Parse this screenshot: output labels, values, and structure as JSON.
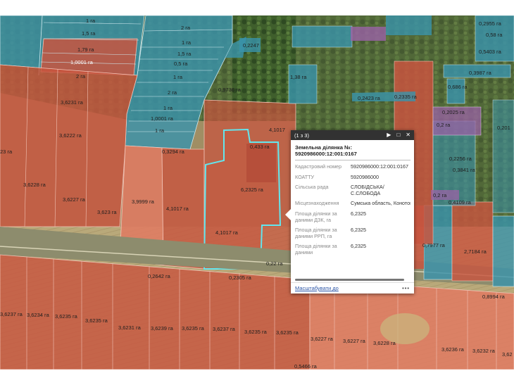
{
  "parcels": {
    "top_blue_left": [
      "1 га",
      "1,5 га",
      "1,79 га",
      "1,0001 га",
      "2 га"
    ],
    "top_blue_mid": [
      "2 га",
      "1 га",
      "1,5 га",
      "0,5 га",
      "1 га",
      "2 га",
      "1 га",
      "1,0001 га",
      "1 га"
    ],
    "top_misc": [
      "0,2247",
      "1,38 га",
      "0,9736 га",
      "0,2335 га",
      "0,2423 га",
      "0,2955 га",
      "0,58 га",
      "0,5403 га",
      "0,3987 га",
      "0,686 га",
      "0,2025 га",
      "0,2256 га",
      "0,3841 га",
      "0,4109 га",
      "0,201",
      "0,2 га",
      "0,2 га"
    ],
    "left_red": [
      "3,6231 га",
      "3,6222 га",
      "3,6228 га",
      "3,6227 га",
      "3,623 га",
      "3,9999 га",
      "4,1017 га",
      "0,3294 га",
      "23 га"
    ],
    "center": [
      "4,1017 га",
      "4,1017",
      "0,433 га",
      "6,2325 га",
      "0,22 га"
    ],
    "right": [
      "0,7977 га",
      "2,7184 га",
      "0,8994 га"
    ],
    "road": [
      "0,2642 га",
      "0,2305 га"
    ],
    "bottom_left": [
      "3,6237 га",
      "3,6234 га",
      "3,6235 га",
      "3,6235 га",
      "3,6231 га",
      "3,6239 га",
      "3,6235 га",
      "3,6237 га",
      "3,6235 га",
      "3,6235 га"
    ],
    "bottom_right": [
      "3,6227 га",
      "3,6227 га",
      "3,6228 га",
      "3,6236 га",
      "3,6232 га",
      "3,62"
    ],
    "bottom_misc": [
      "0,5466 га"
    ]
  },
  "popup": {
    "counter": "(1 з 3)",
    "title_line1": "Земельна ділянка №:",
    "title_line2": "5920986000:12:001:0167",
    "rows": [
      {
        "key": "Кадастровий номер",
        "value": "5920986000:12:001:0167"
      },
      {
        "key": "КОАТТУ",
        "value": "5920986000"
      },
      {
        "key": "Сільська рада",
        "value": "СЛОБІДСЬКА/\nС.СЛОБОДА"
      },
      {
        "key": "Місцезнаходження",
        "value": "Сумська область,\nКонотопський район,\nСлобідський\nстаростинський округ\nБуринської міської ради"
      },
      {
        "key": "Площа ділянки за даними ДЗК, га",
        "value": "6,2325"
      },
      {
        "key": "Площа ділянки за даними РРП, га",
        "value": "6,2325"
      },
      {
        "key": "Площа ділянки за даними",
        "value": "6,2325"
      }
    ],
    "zoom_link": "Масштабувати до",
    "more": "•••"
  },
  "colors": {
    "red_fill": "#c8553f",
    "blue_fill": "#3a93ab",
    "purple_fill": "#9a62a6",
    "highlight": "#62e6ee",
    "field": "#b7a777",
    "forest": "#37512a"
  }
}
